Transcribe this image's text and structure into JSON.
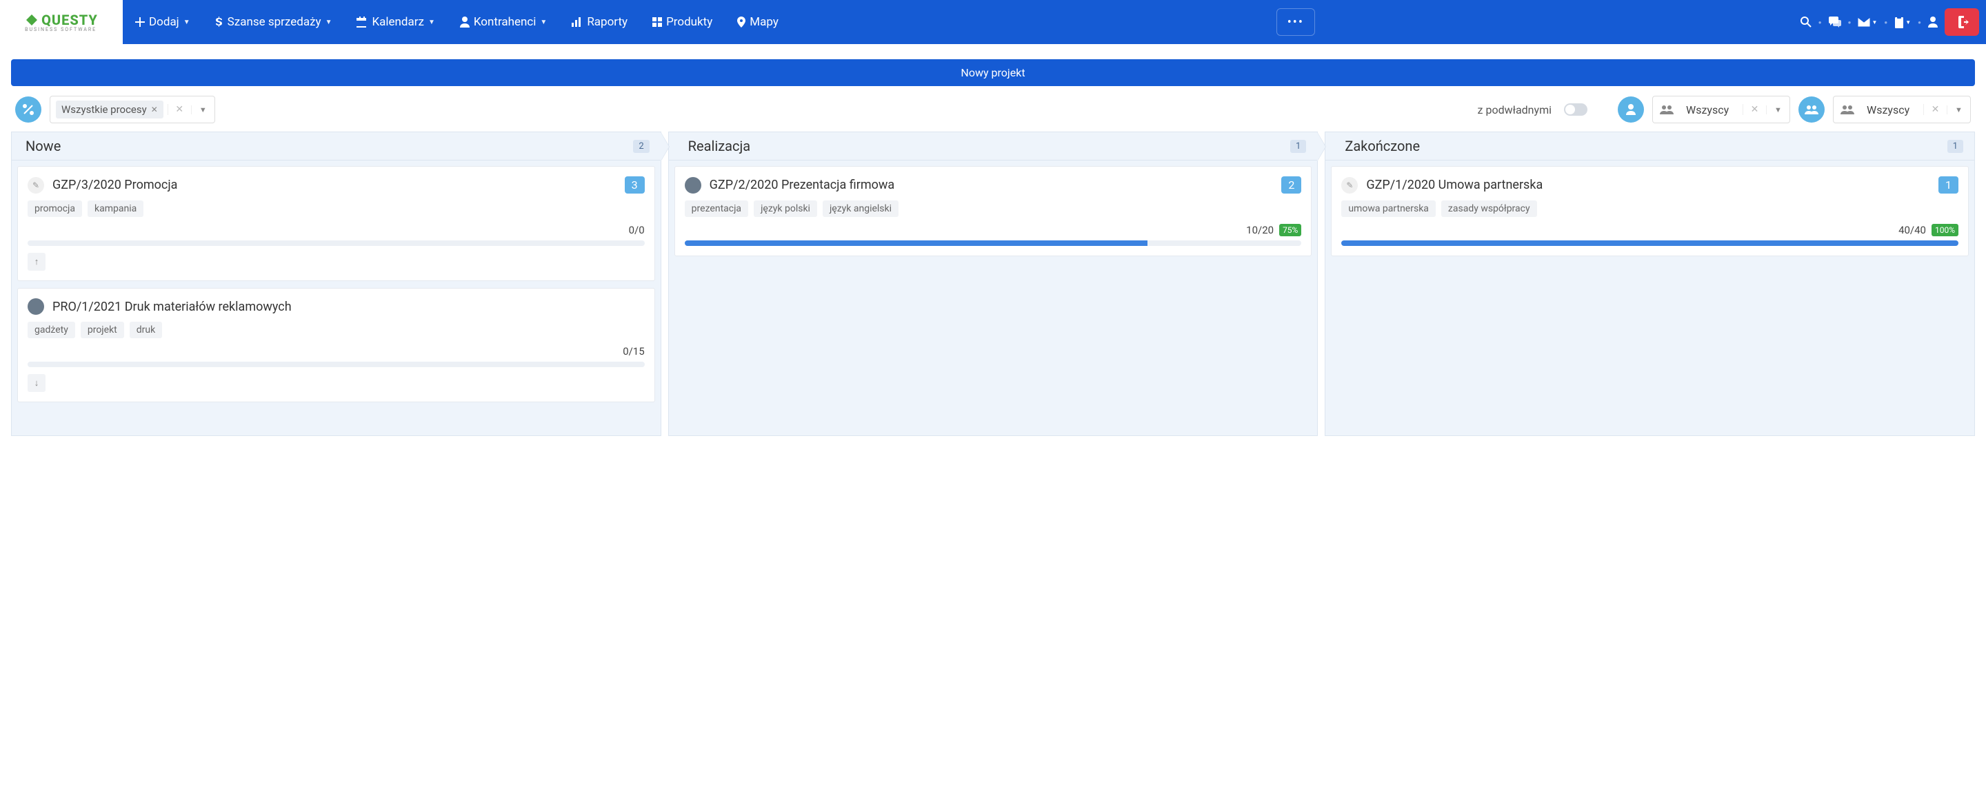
{
  "logo": {
    "text": "QUESTY",
    "sub": "BUSINESS SOFTWARE"
  },
  "nav": {
    "add": "Dodaj",
    "opportunities": "Szanse sprzedaży",
    "calendar": "Kalendarz",
    "contractors": "Kontrahenci",
    "reports": "Raporty",
    "products": "Produkty",
    "maps": "Mapy"
  },
  "new_project": "Nowy projekt",
  "filters": {
    "process_tag": "Wszystkie procesy",
    "subordinates_label": "z podwładnymi",
    "user_value": "Wszyscy",
    "group_value": "Wszyscy"
  },
  "columns": [
    {
      "title": "Nowe",
      "count": "2",
      "cards": [
        {
          "avatar_type": "pen",
          "title": "GZP/3/2020 Promocja",
          "badge": "3",
          "tags": [
            "promocja",
            "kampania"
          ],
          "ratio": "0/0",
          "pct": null,
          "progress": 0,
          "arrow": "up"
        },
        {
          "avatar_type": "person",
          "title": "PRO/1/2021 Druk materiałów reklamowych",
          "badge": null,
          "tags": [
            "gadżety",
            "projekt",
            "druk"
          ],
          "ratio": "0/15",
          "pct": null,
          "progress": 0,
          "arrow": "down"
        }
      ]
    },
    {
      "title": "Realizacja",
      "count": "1",
      "cards": [
        {
          "avatar_type": "person",
          "title": "GZP/2/2020 Prezentacja firmowa",
          "badge": "2",
          "tags": [
            "prezentacja",
            "język polski",
            "język angielski"
          ],
          "ratio": "10/20",
          "pct": "75%",
          "progress": 75,
          "arrow": null
        }
      ]
    },
    {
      "title": "Zakończone",
      "count": "1",
      "cards": [
        {
          "avatar_type": "pen",
          "title": "GZP/1/2020 Umowa partnerska",
          "badge": "1",
          "tags": [
            "umowa partnerska",
            "zasady współpracy"
          ],
          "ratio": "40/40",
          "pct": "100%",
          "progress": 100,
          "arrow": null
        }
      ]
    }
  ]
}
